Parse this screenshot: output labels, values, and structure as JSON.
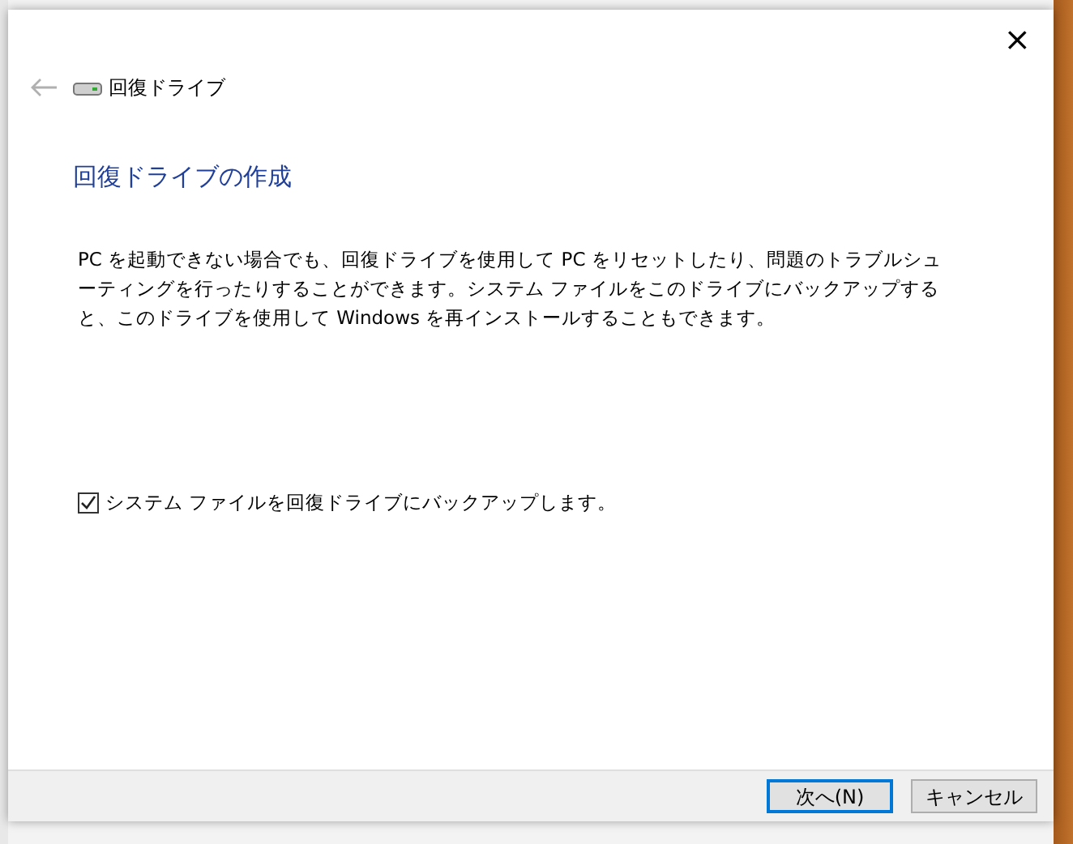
{
  "window": {
    "title": "回復ドライブ",
    "close": "×"
  },
  "heading": "回復ドライブの作成",
  "description": "PC を起動できない場合でも、回復ドライブを使用して PC をリセットしたり、問題のトラブルシューティングを行ったりすることができます。システム ファイルをこのドライブにバックアップすると、このドライブを使用して Windows を再インストールすることもできます。",
  "backup_option": {
    "label": "システム ファイルを回復ドライブにバックアップします。",
    "checked": true
  },
  "buttons": [
    {
      "label": "次へ(N)",
      "default": true
    },
    {
      "label": "キャンセル",
      "default": false
    }
  ]
}
